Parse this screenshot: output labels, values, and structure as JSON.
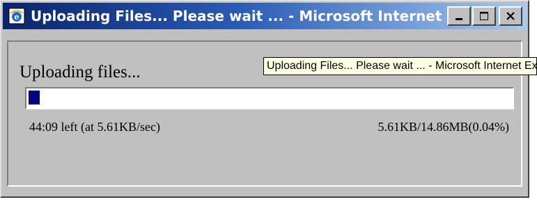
{
  "window": {
    "title": "Uploading Files... Please wait ... - Microsoft Internet ...",
    "icon": "ie-icon",
    "controls": [
      "minimize-icon",
      "maximize-icon",
      "close-icon"
    ]
  },
  "tooltip": {
    "text": "Uploading Files... Please wait ... - Microsoft Internet Explorer"
  },
  "upload": {
    "heading": "Uploading files...",
    "progress_fraction": 0.0004,
    "time_left": "44:09 left (at 5.61KB/sec)",
    "size_progress": "5.61KB/14.86MB(0.04%)"
  },
  "colors": {
    "progress_fill": "#000080",
    "titlebar_start": "#0a246a",
    "titlebar_end": "#a6caf0",
    "window_bg": "#c0c0c0"
  }
}
